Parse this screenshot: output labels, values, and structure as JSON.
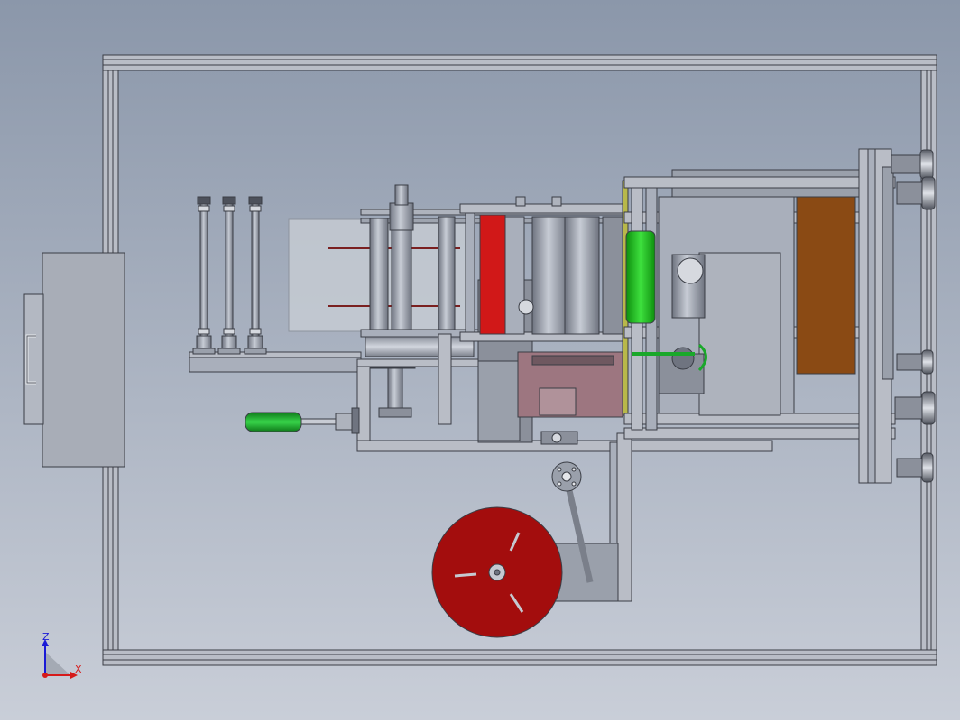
{
  "view": {
    "background_top": "#8b97aa",
    "background_bottom": "#c9ced8"
  },
  "triad": {
    "z_label": "Z",
    "x_label": "X",
    "z_color": "#1a1ad6",
    "x_color": "#d61a1a",
    "origin_color": "#d61a1a"
  },
  "colors": {
    "frame": "#b9bdc6",
    "frame_edge": "#3a3d45",
    "panel": "#a9afbb",
    "film": "#c9cfd6",
    "red_roller": "#d11818",
    "green_roller": "#18c418",
    "handle_green": "#1aa82a",
    "reel": "#a30d0d",
    "brown_board": "#8a4a14",
    "pink_block": "#9d7680",
    "dark_metal": "#6e7380"
  }
}
